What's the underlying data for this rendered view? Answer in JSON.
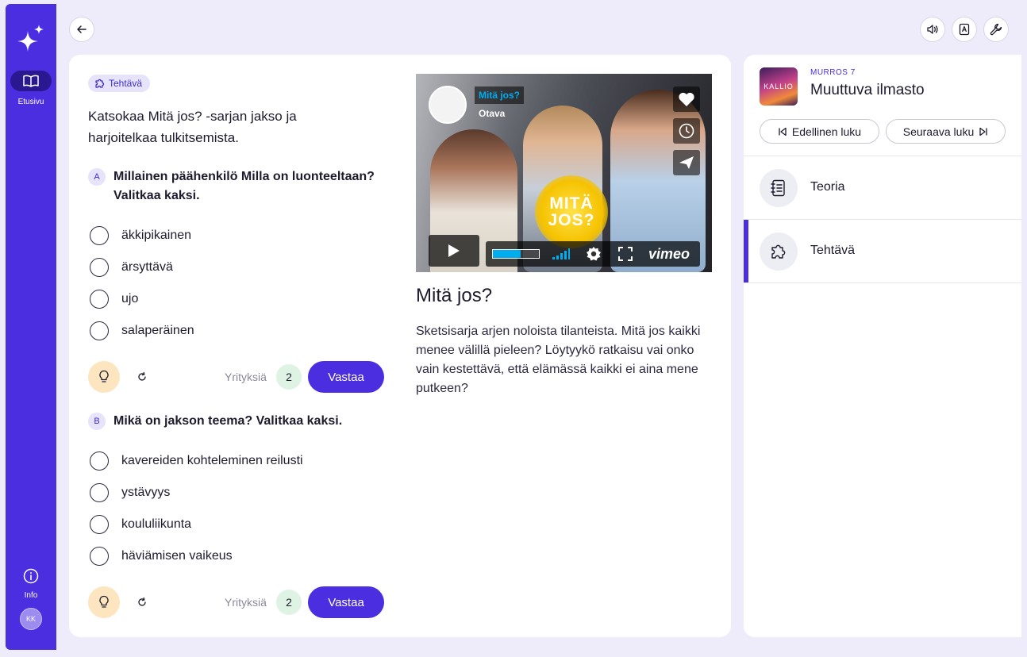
{
  "sidebar": {
    "home_label": "Etusivu",
    "info_label": "Info",
    "avatar_initials": "KK"
  },
  "header": {
    "icons": [
      "back-arrow-icon",
      "speaker-icon",
      "dictionary-icon",
      "wrench-icon"
    ]
  },
  "task": {
    "badge_label": "Tehtävä",
    "intro": "Katsokaa Mitä jos? -sarjan jakso ja harjoitelkaa tulkitsemista.",
    "questions": [
      {
        "letter": "A",
        "text": "Millainen päähenkilö Milla on luonteeltaan? Valitkaa kaksi.",
        "options": [
          "äkkipikainen",
          "ärsyttävä",
          "ujo",
          "salaperäinen"
        ],
        "tries_label": "Yrityksiä",
        "tries": "2",
        "answer_label": "Vastaa"
      },
      {
        "letter": "B",
        "text": "Mikä on jakson teema? Valitkaa kaksi.",
        "options": [
          "kavereiden kohteleminen reilusti",
          "ystävyys",
          "koululiikunta",
          "häviämisen vaikeus"
        ],
        "tries_label": "Yrityksiä",
        "tries": "2",
        "answer_label": "Vastaa"
      }
    ]
  },
  "video": {
    "player_title": "Mitä jos?",
    "channel": "Otava",
    "overlay_line1": "MITÄ",
    "overlay_line2": "JOS?",
    "brand": "vimeo",
    "progress": 0.6,
    "title": "Mitä jos?",
    "description": "Sketsisarja arjen noloista tilanteista. Mitä jos kaikki menee välillä pieleen? Löytyykö ratkaisu vai onko vain kestettävä, että elämässä kaikki ei aina mene putkeen?"
  },
  "chapter": {
    "cover_text": "KALLIO",
    "series": "MURROS 7",
    "title": "Muuttuva ilmasto",
    "prev_label": "Edellinen luku",
    "next_label": "Seuraava luku",
    "sections": [
      {
        "label": "Teoria",
        "icon": "notebook-icon",
        "active": false
      },
      {
        "label": "Tehtävä",
        "icon": "puzzle-icon",
        "active": true
      }
    ]
  },
  "colors": {
    "accent": "#4a2ee0",
    "background": "#eeecfb",
    "hint": "#fde5c0",
    "tries_badge": "#dff3e4"
  }
}
